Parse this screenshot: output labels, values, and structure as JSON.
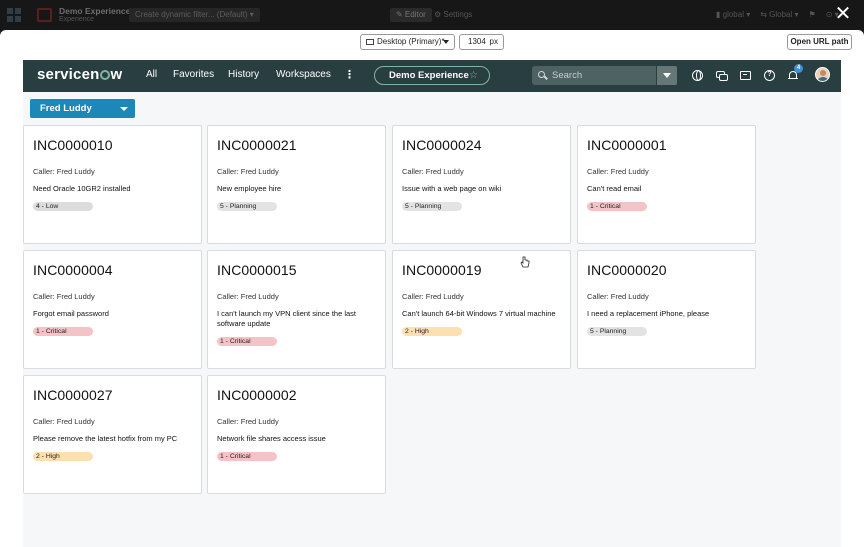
{
  "editor_bar": {
    "app_name": "Demo Experience",
    "app_sub": "Experience",
    "filter_label": "Create dynamic filter... (Default) ▾",
    "editor_label": "✎ Editor",
    "settings_label": "⚙ Settings",
    "right_items": [
      "▮ global ▾",
      "⇆ Global ▾",
      "⚑",
      "⊙ ▾"
    ]
  },
  "close_label": "✕",
  "preview_toolbar": {
    "device_label": "Desktop (Primary)*",
    "width_value": "1304",
    "width_unit": "px",
    "open_url_label": "Open URL path"
  },
  "nav": {
    "logo_pre": "servicen",
    "logo_post": "w",
    "menu": [
      "All",
      "Favorites",
      "History",
      "Workspaces"
    ],
    "more": "⋮",
    "experience_pill": "Demo Experience",
    "experience_star": "☆",
    "search_placeholder": "Search",
    "help_glyph": "?",
    "notification_count": "4"
  },
  "user_dropdown": "Fred Luddy",
  "incidents": [
    {
      "number": "INC0000010",
      "caller": "Caller: Fred Luddy",
      "description": "Need Oracle 10GR2 installed",
      "priority": "4 - Low",
      "level": "low"
    },
    {
      "number": "INC0000021",
      "caller": "Caller: Fred Luddy",
      "description": "New employee hire",
      "priority": "5 - Planning",
      "level": "planning"
    },
    {
      "number": "INC0000024",
      "caller": "Caller: Fred Luddy",
      "description": "Issue with a web page on wiki",
      "priority": "5 - Planning",
      "level": "planning"
    },
    {
      "number": "INC0000001",
      "caller": "Caller: Fred Luddy",
      "description": "Can't read email",
      "priority": "1 - Critical",
      "level": "critical"
    },
    {
      "number": "INC0000004",
      "caller": "Caller: Fred Luddy",
      "description": "Forgot email password",
      "priority": "1 - Critical",
      "level": "critical"
    },
    {
      "number": "INC0000015",
      "caller": "Caller: Fred Luddy",
      "description": "I can't launch my VPN client since the last software update",
      "priority": "1 - Critical",
      "level": "critical"
    },
    {
      "number": "INC0000019",
      "caller": "Caller: Fred Luddy",
      "description": "Can't launch 64-bit Windows 7 virtual machine",
      "priority": "2 - High",
      "level": "high"
    },
    {
      "number": "INC0000020",
      "caller": "Caller: Fred Luddy",
      "description": "I need a replacement iPhone, please",
      "priority": "5 - Planning",
      "level": "planning"
    },
    {
      "number": "INC0000027",
      "caller": "Caller: Fred Luddy",
      "description": "Please remove the latest hotfix from my PC",
      "priority": "2 - High",
      "level": "high"
    },
    {
      "number": "INC0000002",
      "caller": "Caller: Fred Luddy",
      "description": "Network file shares access issue",
      "priority": "1 - Critical",
      "level": "critical"
    }
  ],
  "colors": {
    "nav_bg": "#293e40",
    "accent_green": "#81b5a1",
    "dropdown_blue": "#1c87b8",
    "critical": "#f4c3c7",
    "high": "#fde0b0",
    "planning": "#e3e3e3",
    "low": "#dcdcdc"
  }
}
